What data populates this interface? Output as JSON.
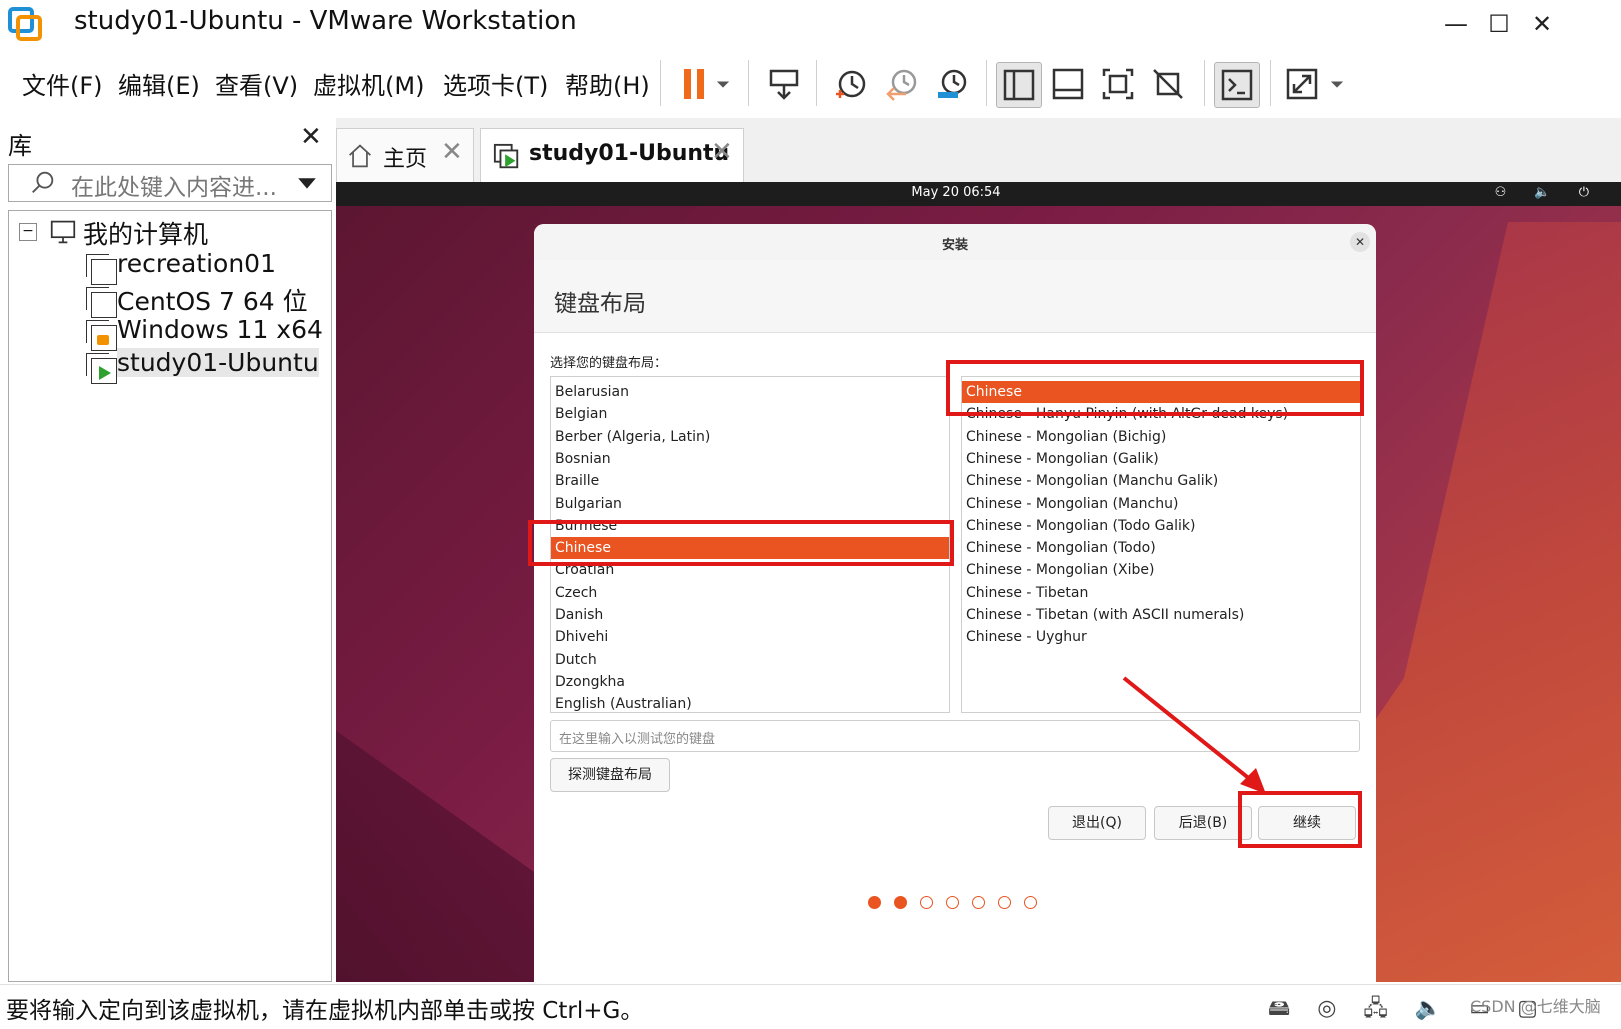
{
  "window": {
    "title": "study01-Ubuntu - VMware Workstation",
    "minimize": "—",
    "maximize": "☐",
    "close": "✕"
  },
  "menu": [
    "文件(F)",
    "编辑(E)",
    "查看(V)",
    "虚拟机(M)",
    "选项卡(T)",
    "帮助(H)"
  ],
  "toolbar": {
    "icons": [
      "pause-icon",
      "send-ctrl-alt-del-icon",
      "snapshot-icon",
      "revert-snapshot-icon",
      "snapshot-manager-icon",
      "show-library-icon",
      "thumbnail-bar-icon",
      "fullscreen-icon",
      "unity-icon",
      "console-view-icon",
      "stretch-guest-icon"
    ]
  },
  "library": {
    "title": "库",
    "close": "✕",
    "search_placeholder": "在此处键入内容进...",
    "tree": {
      "root": "我的计算机",
      "root_toggle": "−",
      "items": [
        "recreation01",
        "CentOS 7 64 位",
        "Windows 11 x64",
        "study01-Ubuntu"
      ]
    }
  },
  "tabs": [
    {
      "label": "主页",
      "close": "✕"
    },
    {
      "label": "study01-Ubuntu",
      "close": "✕"
    }
  ],
  "vm": {
    "clock": "May 20  06:54",
    "tray": "⚇ 🔈 ⏻",
    "dialog": {
      "title": "安装",
      "close": "✕",
      "heading": "键盘布局",
      "choose_label": "选择您的键盘布局：",
      "layouts": [
        "Belarusian",
        "Belgian",
        "Berber (Algeria, Latin)",
        "Bosnian",
        "Braille",
        "Bulgarian",
        "Burmese",
        "Chinese",
        "Croatian",
        "Czech",
        "Danish",
        "Dhivehi",
        "Dutch",
        "Dzongkha",
        "English (Australian)"
      ],
      "variants": [
        "Chinese",
        "Chinese - Hanyu Pinyin (with AltGr dead keys)",
        "Chinese - Mongolian (Bichig)",
        "Chinese - Mongolian (Galik)",
        "Chinese - Mongolian (Manchu Galik)",
        "Chinese - Mongolian (Manchu)",
        "Chinese - Mongolian (Todo Galik)",
        "Chinese - Mongolian (Todo)",
        "Chinese - Mongolian (Xibe)",
        "Chinese - Tibetan",
        "Chinese - Tibetan (with ASCII numerals)",
        "Chinese - Uyghur"
      ],
      "selected_layout": "Chinese",
      "selected_variant": "Chinese",
      "test_placeholder": "在这里输入以测试您的键盘",
      "detect_button": "探测键盘布局",
      "quit_button": "退出(Q)",
      "back_button": "后退(B)",
      "continue_button": "继续",
      "progress": {
        "total": 7,
        "completed": 2
      },
      "accent": "#e95420"
    }
  },
  "status": {
    "message": "要将输入定向到该虚拟机，请在虚拟机内部单击或按 Ctrl+G。",
    "icons": "🖴 ◎ 🖧 🔈 ▭ ▢",
    "watermark": "CSDN @七维大脑"
  }
}
